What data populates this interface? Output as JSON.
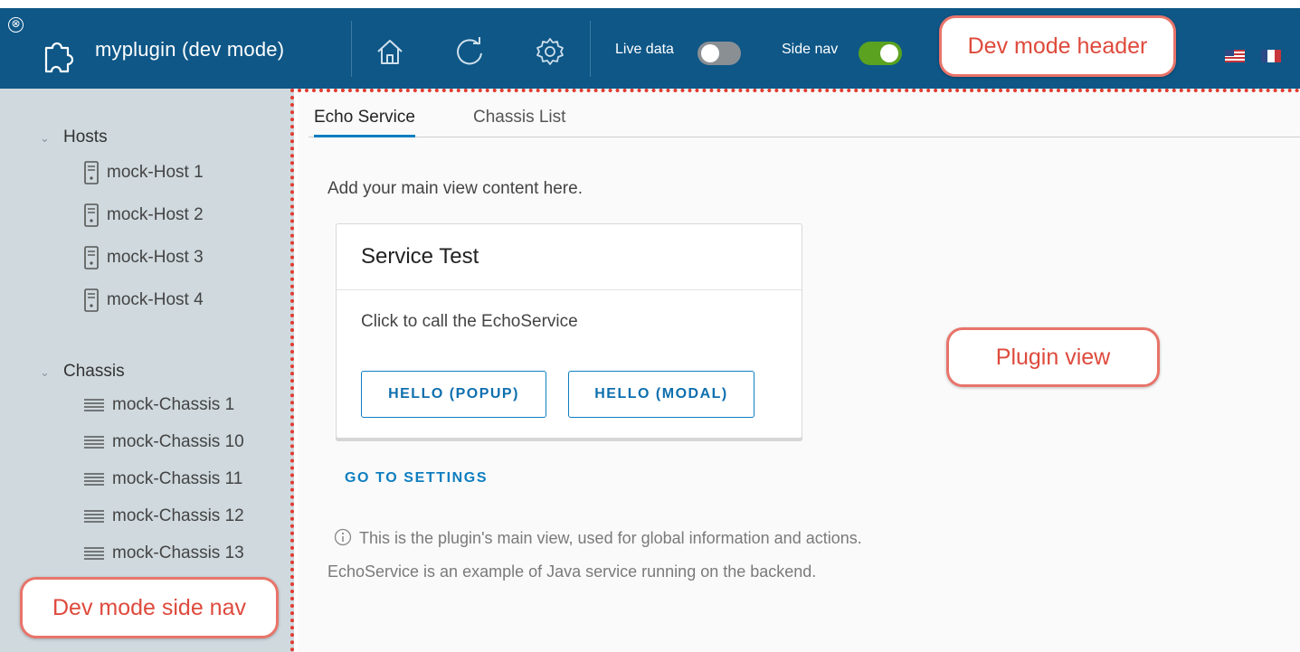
{
  "header": {
    "close_glyph": "⊗",
    "title": "myplugin (dev mode)",
    "icons": [
      "plugin-icon",
      "home-icon",
      "refresh-icon",
      "settings-icon"
    ],
    "live_data_label": "Live data",
    "live_data_on": false,
    "side_nav_label": "Side nav",
    "side_nav_on": true,
    "bg_color": "#0e5787"
  },
  "callouts": {
    "header": "Dev mode header",
    "plugin_view": "Plugin view",
    "side_nav": "Dev mode side nav"
  },
  "sidebar": {
    "groups": [
      {
        "label": "Hosts",
        "icon": "server-icon",
        "items": [
          "mock-Host 1",
          "mock-Host 2",
          "mock-Host 3",
          "mock-Host 4"
        ]
      },
      {
        "label": "Chassis",
        "icon": "list-icon",
        "items": [
          "mock-Chassis 1",
          "mock-Chassis 10",
          "mock-Chassis 11",
          "mock-Chassis 12",
          "mock-Chassis 13"
        ]
      }
    ]
  },
  "main": {
    "tabs": [
      {
        "label": "Echo Service",
        "active": true
      },
      {
        "label": "Chassis List",
        "active": false
      }
    ],
    "intro": "Add your main view content here.",
    "card": {
      "title": "Service Test",
      "text": "Click to call the EchoService",
      "buttons": [
        "HELLO (POPUP)",
        "HELLO (MODAL)"
      ]
    },
    "settings_link": "GO TO SETTINGS",
    "info_line1": "This is the plugin's main view, used for global information and actions.",
    "info_line2": "EchoService is an example of Java service running on the backend."
  },
  "colors": {
    "accent": "#0e7ec0",
    "sidebar_bg": "#cfd9de",
    "toggle_on": "#5aa220",
    "callout_red": "#de4a3c"
  }
}
